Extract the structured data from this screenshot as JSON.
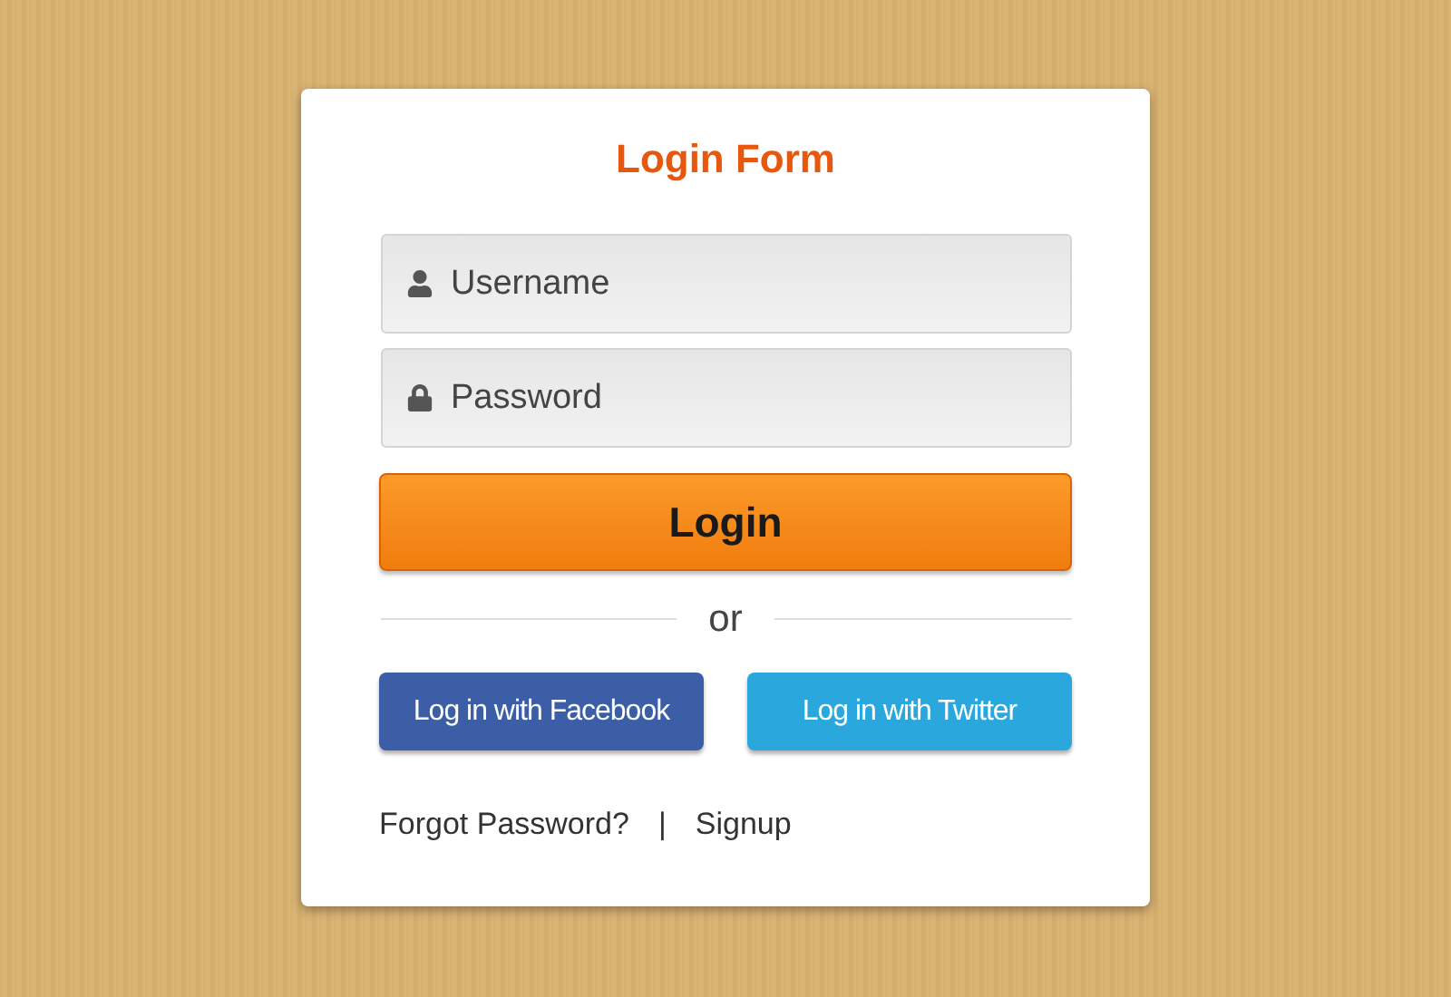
{
  "title": "Login Form",
  "fields": [
    {
      "placeholder": "Username",
      "kind": "user"
    },
    {
      "placeholder": "Password",
      "kind": "password"
    }
  ],
  "login_button": "Login",
  "divider": "or",
  "social_buttons": [
    {
      "label": "Log in with Facebook",
      "color": "#3b5ea6"
    },
    {
      "label": "Log in with Twitter",
      "color": "#2aa8de"
    }
  ],
  "links": [
    "Forgot Password?",
    "Signup"
  ],
  "separator": "|"
}
